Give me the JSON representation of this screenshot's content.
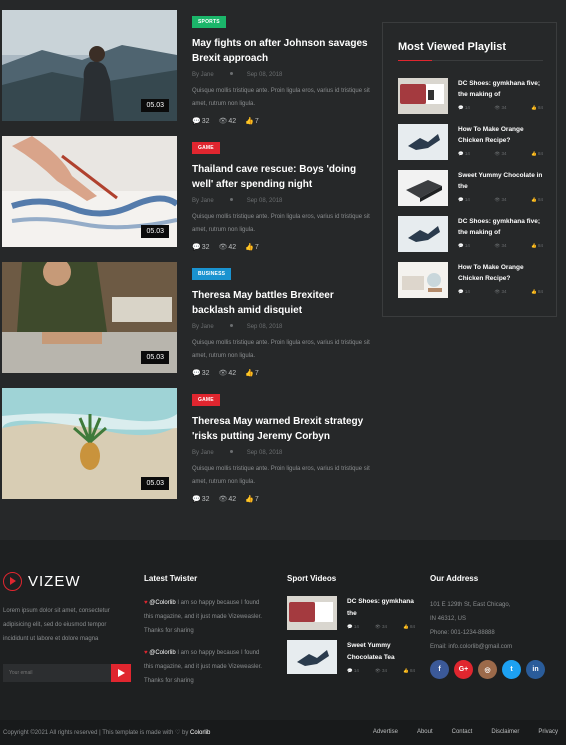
{
  "posts": [
    {
      "category": "Sports",
      "category_color": "#1bb66a",
      "title": "May fights on after Johnson savages Brexit approach",
      "author": "By Jane",
      "date": "Sep 08, 2018",
      "excerpt": "Quisque mollis tristique ante. Proin ligula eros, varius id tristique sit amet, rutrum non ligula.",
      "comments": "32",
      "views": "42",
      "likes": "7",
      "duration": "05.03"
    },
    {
      "category": "Game",
      "category_color": "#e0262f",
      "title": "Thailand cave rescue: Boys 'doing well' after spending night",
      "author": "By Jane",
      "date": "Sep 08, 2018",
      "excerpt": "Quisque mollis tristique ante. Proin ligula eros, varius id tristique sit amet, rutrum non ligula.",
      "comments": "32",
      "views": "42",
      "likes": "7",
      "duration": "05.03"
    },
    {
      "category": "Business",
      "category_color": "#1a93d0",
      "title": "Theresa May battles Brexiteer backlash amid disquiet",
      "author": "By Jane",
      "date": "Sep 08, 2018",
      "excerpt": "Quisque mollis tristique ante. Proin ligula eros, varius id tristique sit amet, rutrum non ligula.",
      "comments": "32",
      "views": "42",
      "likes": "7",
      "duration": "05.03"
    },
    {
      "category": "Game",
      "category_color": "#e0262f",
      "title": "Theresa May warned Brexit strategy 'risks putting Jeremy Corbyn",
      "author": "By Jane",
      "date": "Sep 08, 2018",
      "excerpt": "Quisque mollis tristique ante. Proin ligula eros, varius id tristique sit amet, rutrum non ligula.",
      "comments": "32",
      "views": "42",
      "likes": "7",
      "duration": "05.03"
    }
  ],
  "playlist": {
    "title": "Most Viewed Playlist",
    "items": [
      {
        "title": "DC Shoes: gymkhana five; the making of",
        "comments": "14",
        "views": "34",
        "likes": "84"
      },
      {
        "title": "How To Make Orange Chicken Recipe?",
        "comments": "14",
        "views": "34",
        "likes": "84"
      },
      {
        "title": "Sweet Yummy Chocolate in the",
        "comments": "14",
        "views": "34",
        "likes": "84"
      },
      {
        "title": "DC Shoes: gymkhana five; the making of",
        "comments": "14",
        "views": "34",
        "likes": "84"
      },
      {
        "title": "How To Make Orange Chicken Recipe?",
        "comments": "14",
        "views": "34",
        "likes": "84"
      }
    ]
  },
  "footer": {
    "logo_text": "VIZEW",
    "about": "Lorem ipsum dolor sit amet, consectetur adipisicing elit, sed do eiusmod tempor incididunt ut labore et dolore magna",
    "email_placeholder": "Your email",
    "twitter_heading": "Latest Twister",
    "tweets": [
      {
        "handle": "@Colorlib",
        "text": " I am so happy because I found this magazine, and it just made Vizeweasler. Thanks for sharing"
      },
      {
        "handle": "@Colorlib",
        "text": " I am so happy because I found this magazine, and it just made Vizeweasler. Thanks for sharing"
      }
    ],
    "videos_heading": "Sport Videos",
    "videos": [
      {
        "title": "DC Shoes: gymkhana the",
        "comments": "14",
        "views": "34",
        "likes": "84"
      },
      {
        "title": "Sweet Yummy Chocolatea Tea",
        "comments": "14",
        "views": "34",
        "likes": "84"
      }
    ],
    "address_heading": "Our Address",
    "address_line1": "101 E 129th St, East Chicago,",
    "address_line2": "IN 46312, US",
    "phone": "Phone: 001-1234-88888",
    "email": "Email: info.colorlib@gmail.com",
    "social": [
      {
        "icon": "facebook-icon",
        "glyph": "f",
        "color": "#3b5998"
      },
      {
        "icon": "google-plus-icon",
        "glyph": "G+",
        "color": "#e0262f"
      },
      {
        "icon": "instagram-icon",
        "glyph": "◎",
        "color": "#9c6a4a"
      },
      {
        "icon": "twitter-icon",
        "glyph": "t",
        "color": "#1da1f2"
      },
      {
        "icon": "linkedin-icon",
        "glyph": "in",
        "color": "#2a5c9a"
      }
    ]
  },
  "bottom": {
    "copyright": "Copyright ©2021 All rights reserved | This template is made with ♡ by ",
    "brand": "Colorlib",
    "links": [
      "Advertise",
      "About",
      "Contact",
      "Disclaimer",
      "Privacy"
    ]
  }
}
